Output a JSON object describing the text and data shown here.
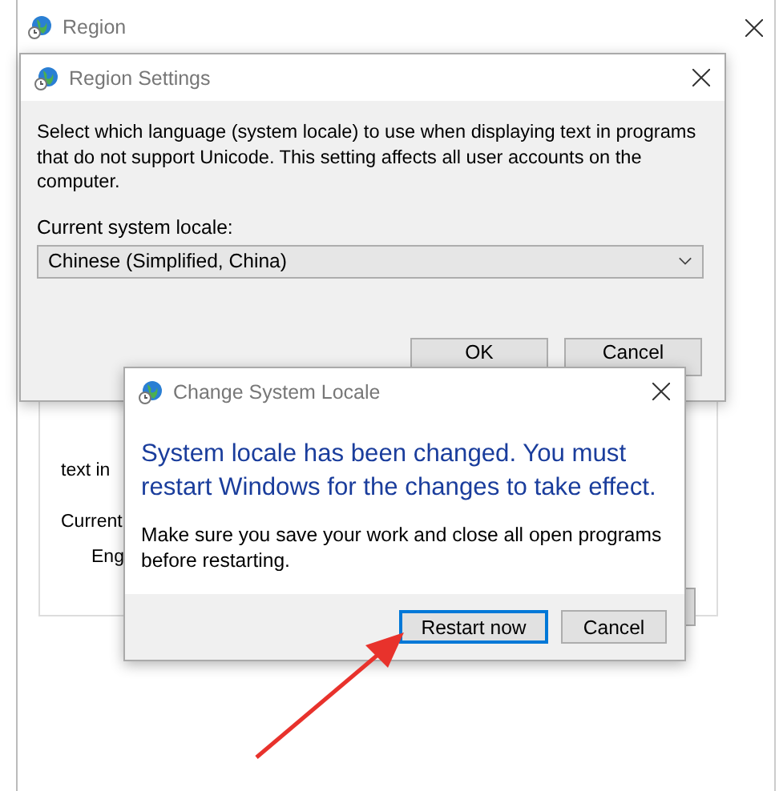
{
  "background_window": {
    "title": "Region",
    "partial_texts": [
      "text in",
      "Current",
      "Eng"
    ]
  },
  "region_settings": {
    "title": "Region Settings",
    "description": "Select which language (system locale) to use when displaying text in programs that do not support Unicode. This setting affects all user accounts on the computer.",
    "locale_label": "Current system locale:",
    "locale_value": "Chinese (Simplified, China)",
    "buttons": [
      {
        "label": "OK",
        "default": false
      },
      {
        "label": "Cancel",
        "default": false
      }
    ]
  },
  "change_locale_dialog": {
    "title": "Change System Locale",
    "main_instruction": "System locale has been changed. You must restart Windows for the changes to take effect.",
    "content": "Make sure you save your work and close all open programs before restarting.",
    "buttons": [
      {
        "label": "Restart now",
        "default": true
      },
      {
        "label": "Cancel",
        "default": false
      }
    ]
  }
}
